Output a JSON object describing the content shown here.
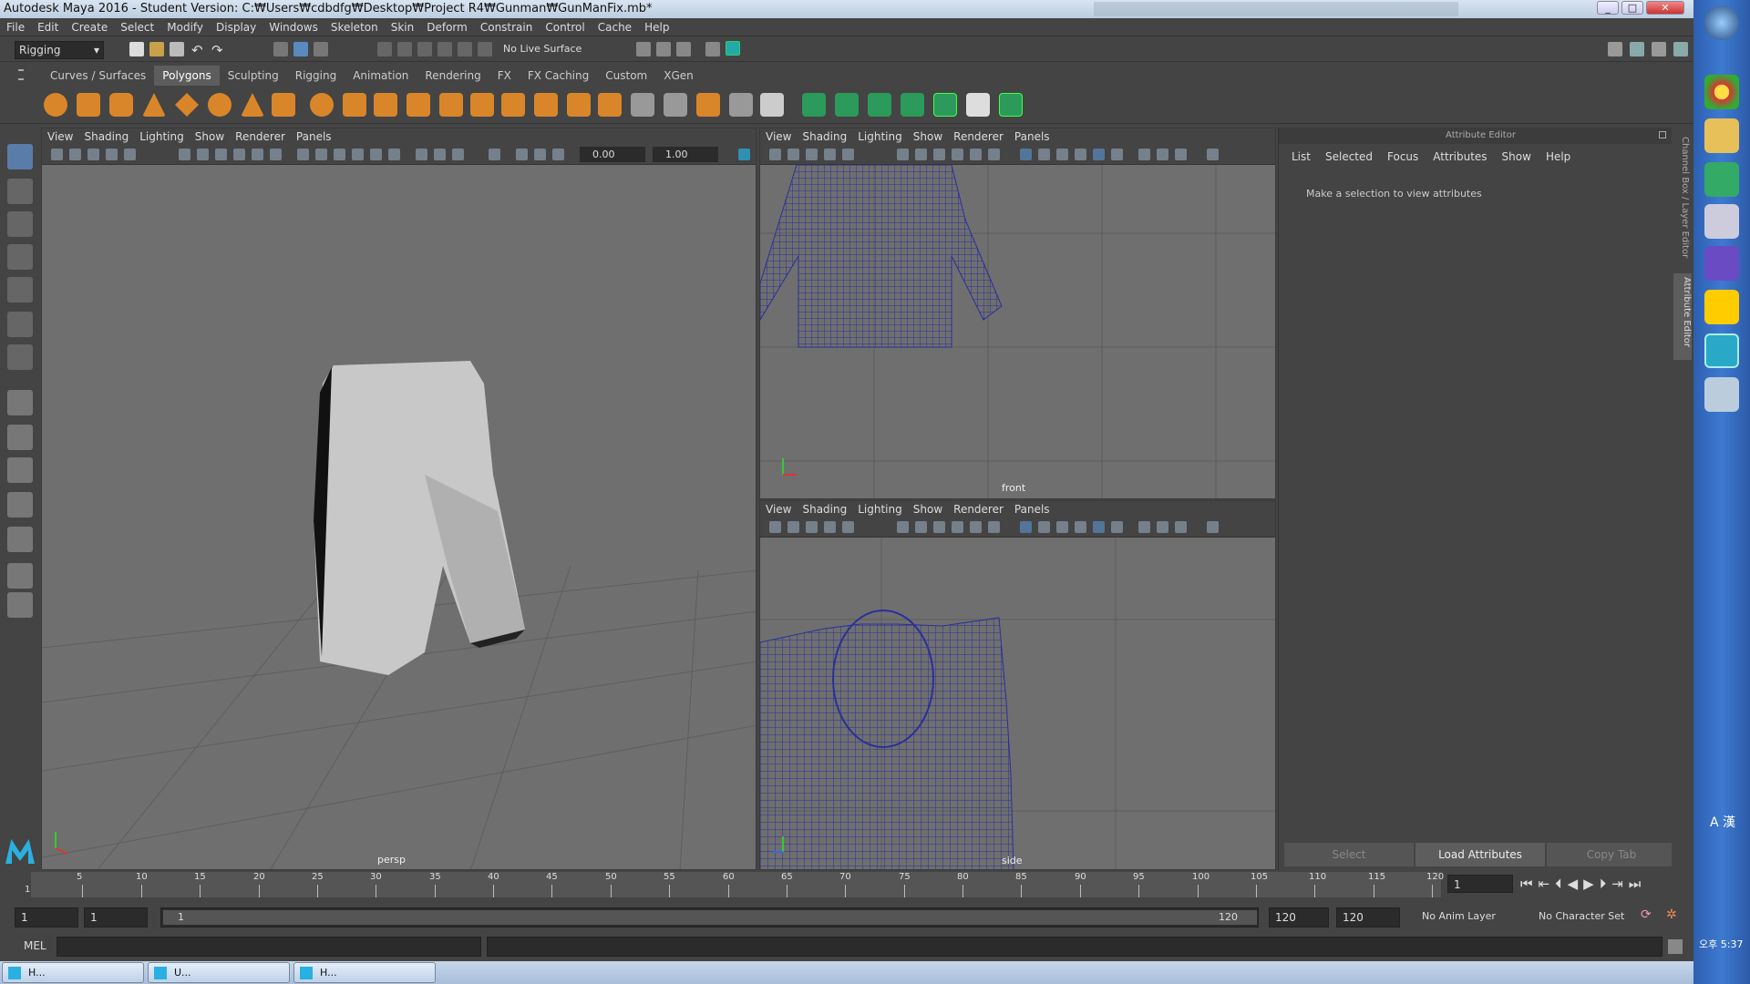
{
  "title": "Autodesk Maya 2016 - Student Version: C:₩Users₩cdbdfg₩Desktop₩Project R4₩Gunman₩GunManFix.mb*",
  "menu": [
    "File",
    "Edit",
    "Create",
    "Select",
    "Modify",
    "Display",
    "Windows",
    "Skeleton",
    "Skin",
    "Deform",
    "Constrain",
    "Control",
    "Cache",
    "Help"
  ],
  "status": {
    "menuset": "Rigging",
    "live_surface": "No Live Surface"
  },
  "shelf_tabs": [
    "Curves / Surfaces",
    "Polygons",
    "Sculpting",
    "Rigging",
    "Animation",
    "Rendering",
    "FX",
    "FX Caching",
    "Custom",
    "XGen"
  ],
  "viewport_menu": [
    "View",
    "Shading",
    "Lighting",
    "Show",
    "Renderer",
    "Panels"
  ],
  "persp": {
    "label": "persp",
    "field1": "0.00",
    "field2": "1.00"
  },
  "front": {
    "label": "front"
  },
  "side": {
    "label": "side"
  },
  "attr": {
    "header": "Attribute Editor",
    "menu": [
      "List",
      "Selected",
      "Focus",
      "Attributes",
      "Show",
      "Help"
    ],
    "message": "Make a selection to view attributes",
    "select": "Select",
    "load": "Load Attributes",
    "copy": "Copy Tab",
    "side_tab1": "Channel Box / Layer Editor",
    "side_tab2": "Attribute Editor"
  },
  "timeline": {
    "ticks": [
      "5",
      "10",
      "15",
      "20",
      "25",
      "30",
      "35",
      "40",
      "45",
      "50",
      "55",
      "60",
      "65",
      "70",
      "75",
      "80",
      "85",
      "90",
      "95",
      "100",
      "105",
      "110",
      "115",
      "120"
    ],
    "current": "1",
    "start_marker": "1"
  },
  "range": {
    "start": "1",
    "playstart": "1",
    "slider_start": "1",
    "slider_end": "120",
    "playend": "120",
    "end": "120",
    "anim_layer": "No Anim Layer",
    "char_set": "No Character Set"
  },
  "cmd": {
    "label": "MEL"
  },
  "taskbar": [
    {
      "label": "H..."
    },
    {
      "label": "U..."
    },
    {
      "label": "H..."
    }
  ],
  "tray": {
    "ime": "A 漢",
    "clock": "오후 5:37"
  },
  "colors": {
    "mesh": "#2b2f9a",
    "viewport": "#6f6f6f",
    "accent": "#2ab0e0"
  }
}
